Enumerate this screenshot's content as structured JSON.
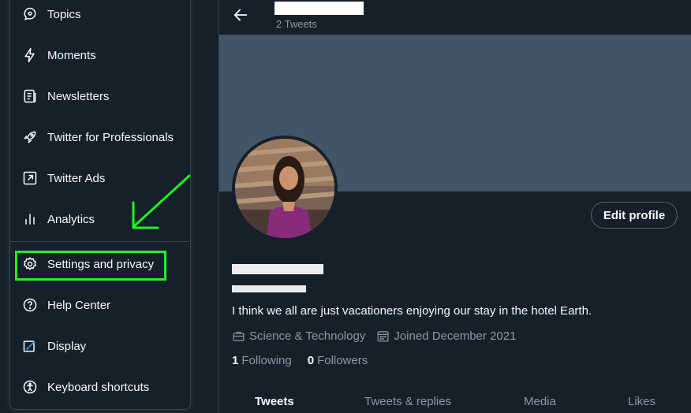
{
  "sidebar": {
    "items": [
      {
        "label": "Topics",
        "icon": "topics-icon"
      },
      {
        "label": "Moments",
        "icon": "lightning-icon"
      },
      {
        "label": "Newsletters",
        "icon": "newsletter-icon"
      },
      {
        "label": "Twitter for Professionals",
        "icon": "rocket-icon"
      },
      {
        "label": "Twitter Ads",
        "icon": "external-arrow-icon"
      },
      {
        "label": "Analytics",
        "icon": "analytics-icon"
      },
      {
        "label": "Settings and privacy",
        "icon": "gear-icon"
      },
      {
        "label": "Help Center",
        "icon": "help-icon"
      },
      {
        "label": "Display",
        "icon": "display-icon"
      },
      {
        "label": "Keyboard shortcuts",
        "icon": "accessibility-icon"
      }
    ]
  },
  "header": {
    "tweet_count": "2 Tweets"
  },
  "profile": {
    "edit_label": "Edit profile",
    "bio": "I think we all are just vacationers enjoying our stay in the hotel Earth.",
    "category": "Science & Technology",
    "joined": "Joined December 2021",
    "following_count": "1",
    "following_label": "Following",
    "followers_count": "0",
    "followers_label": "Followers"
  },
  "tabs": [
    "Tweets",
    "Tweets & replies",
    "Media",
    "Likes"
  ],
  "colors": {
    "background": "#15202b",
    "banner": "#425466",
    "highlight": "#1ff21f",
    "secondary_text": "#8b98a5",
    "border": "#38444d"
  }
}
